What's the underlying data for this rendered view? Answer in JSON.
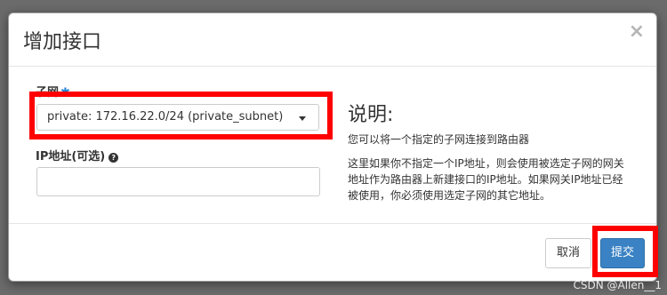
{
  "dialog": {
    "title": "增加接口",
    "close_glyph": "×"
  },
  "form": {
    "subnet_label": "子网",
    "required_mark": "✱",
    "subnet_value": "private: 172.16.22.0/24 (private_subnet)",
    "ip_label": "IP地址(可选)",
    "ip_value": ""
  },
  "description": {
    "title": "说明:",
    "line1": "您可以将一个指定的子网连接到路由器",
    "line2": "这里如果你不指定一个IP地址，则会使用被选定子网的网关地址作为路由器上新建接口的IP地址。如果网关IP地址已经被使用，你必须使用选定子网的其它地址。"
  },
  "footer": {
    "cancel_label": "取消",
    "submit_label": "提交"
  },
  "watermark": "CSDN @Allen__1",
  "colors": {
    "highlight": "#ff0000",
    "primary": "#3a82c4",
    "required": "#1f7fd0"
  },
  "icons": {
    "help": "question-circle-icon",
    "close": "close-icon",
    "dropdown": "caret-down-icon"
  }
}
